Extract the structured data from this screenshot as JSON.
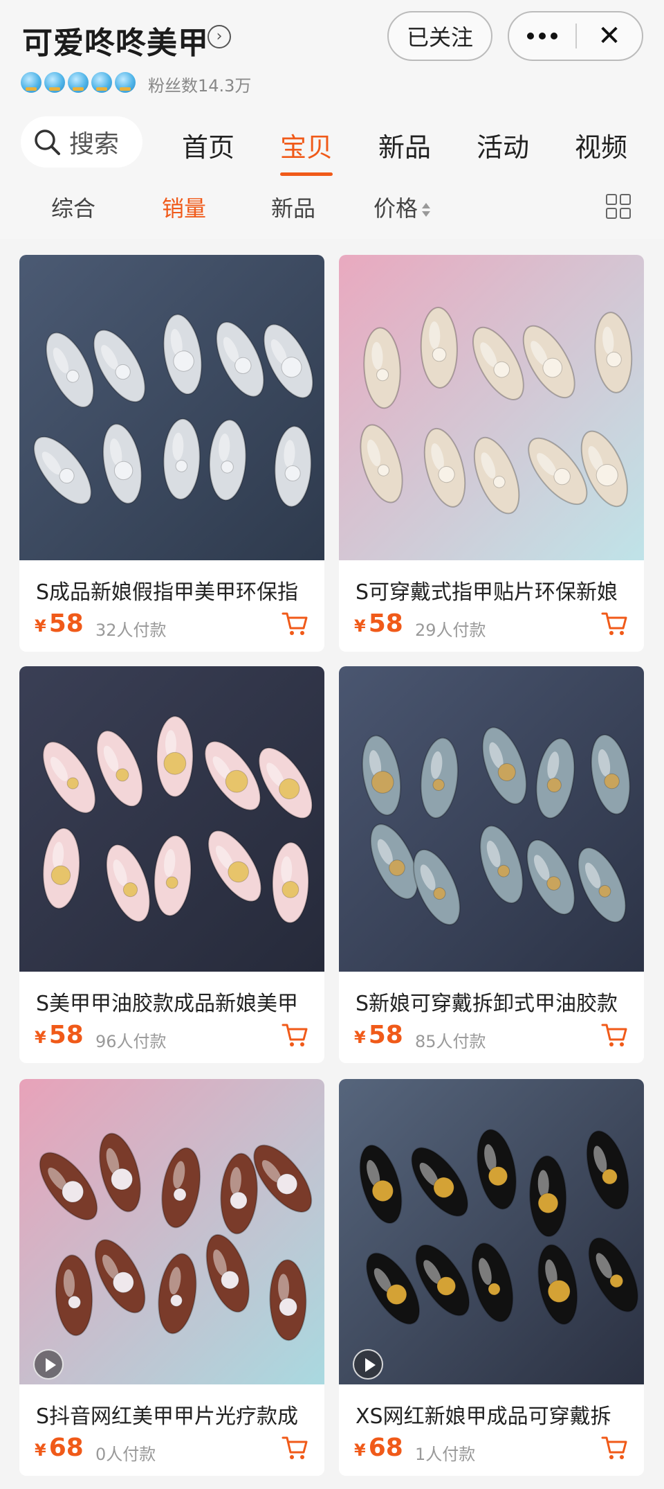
{
  "shop": {
    "name": "可爱咚咚美甲",
    "follow_label": "已关注",
    "fans_label": "粉丝数14.3万",
    "crown_count": 5
  },
  "nav": {
    "search_label": "搜索",
    "tabs": [
      "首页",
      "宝贝",
      "新品",
      "活动",
      "视频"
    ],
    "active_tab": "宝贝"
  },
  "sort": {
    "items": [
      "综合",
      "销量",
      "新品",
      "价格"
    ],
    "active": "销量"
  },
  "colors": {
    "accent": "#f05a19",
    "background": "#f4f4f4",
    "card": "#ffffff"
  },
  "products": [
    {
      "title": "S成品新娘假指甲美甲环保指",
      "currency": "¥",
      "price": "58",
      "sold": "32人付款",
      "video": false
    },
    {
      "title": "S可穿戴式指甲贴片环保新娘",
      "currency": "¥",
      "price": "58",
      "sold": "29人付款",
      "video": false
    },
    {
      "title": "S美甲甲油胶款成品新娘美甲",
      "currency": "¥",
      "price": "58",
      "sold": "96人付款",
      "video": false
    },
    {
      "title": "S新娘可穿戴拆卸式甲油胶款",
      "currency": "¥",
      "price": "58",
      "sold": "85人付款",
      "video": false
    },
    {
      "title": "S抖音网红美甲甲片光疗款成",
      "currency": "¥",
      "price": "68",
      "sold": "0人付款",
      "video": true
    },
    {
      "title": "XS网红新娘甲成品可穿戴拆",
      "currency": "¥",
      "price": "68",
      "sold": "1人付款",
      "video": true
    }
  ]
}
